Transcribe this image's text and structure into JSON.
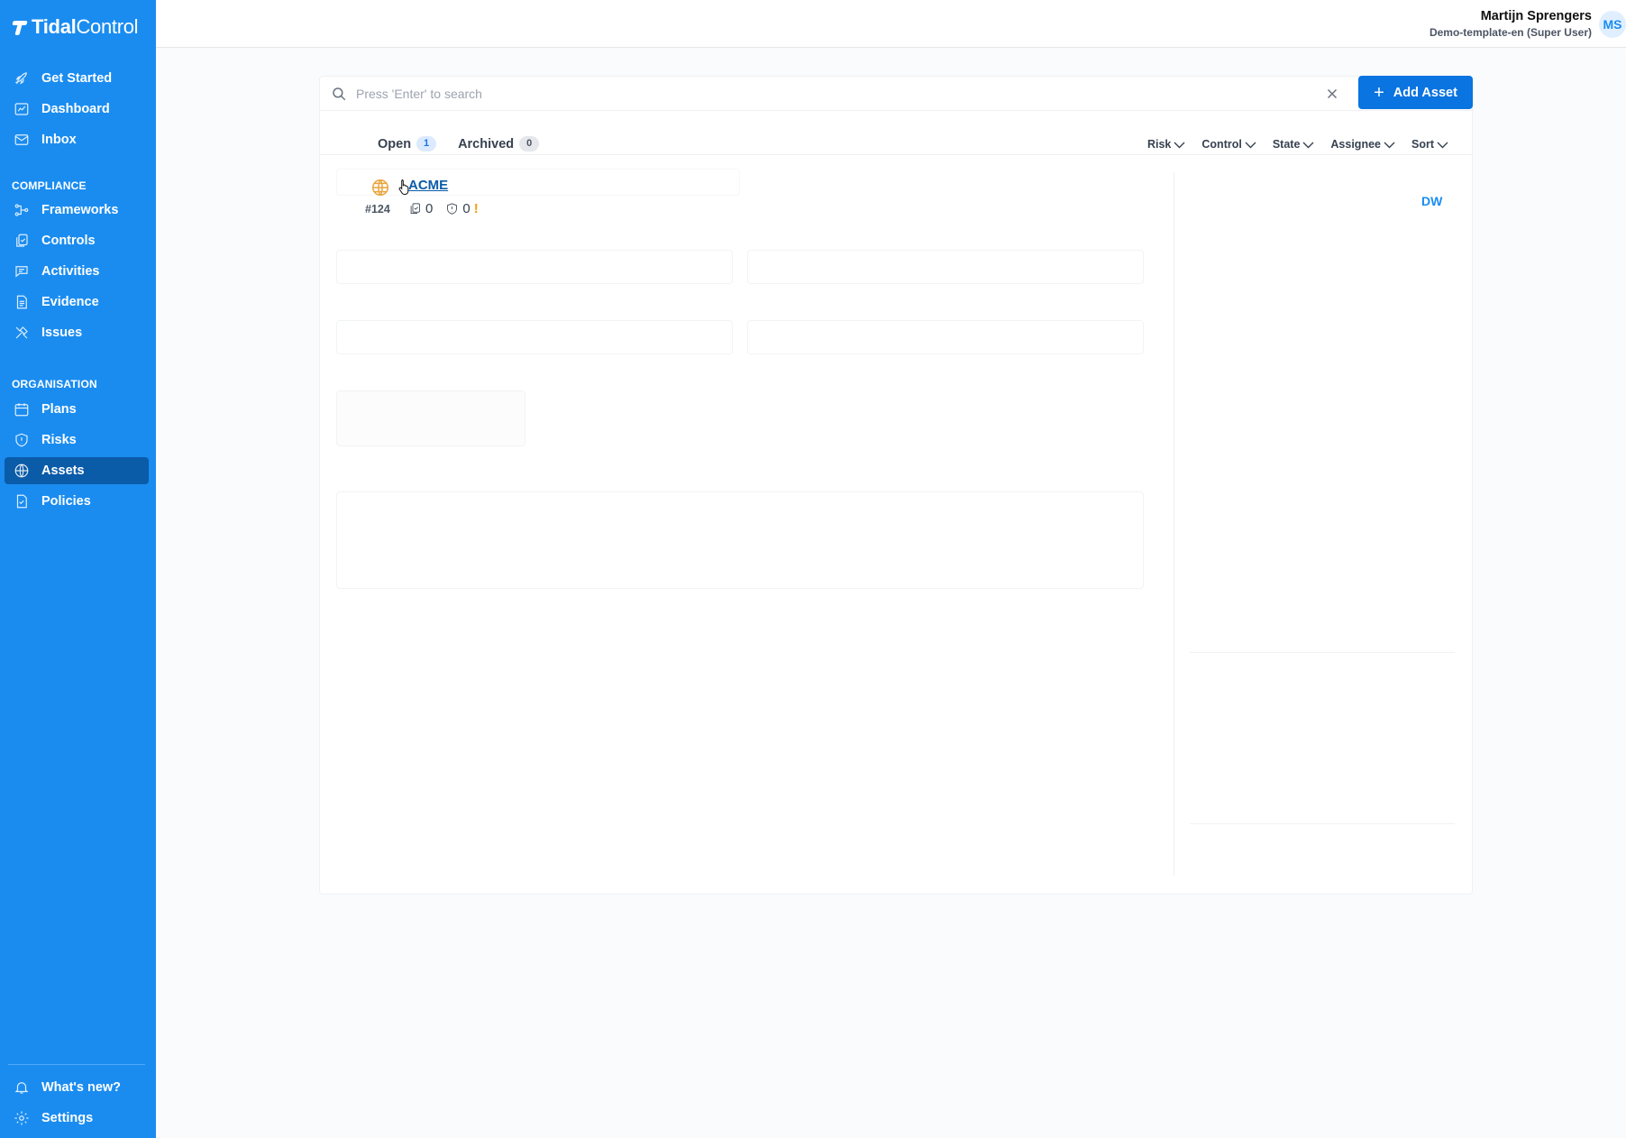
{
  "app": {
    "logo_bold": "Tidal",
    "logo_light": "Control"
  },
  "sidebar": {
    "top_items": [
      {
        "label": "Get Started",
        "icon": "rocket-icon"
      },
      {
        "label": "Dashboard",
        "icon": "dashboard-icon"
      },
      {
        "label": "Inbox",
        "icon": "mail-icon"
      }
    ],
    "sections": [
      {
        "title": "COMPLIANCE",
        "items": [
          {
            "label": "Frameworks",
            "icon": "frameworks-icon"
          },
          {
            "label": "Controls",
            "icon": "controls-icon"
          },
          {
            "label": "Activities",
            "icon": "activities-icon"
          },
          {
            "label": "Evidence",
            "icon": "evidence-icon"
          },
          {
            "label": "Issues",
            "icon": "issues-icon"
          }
        ]
      },
      {
        "title": "ORGANISATION",
        "items": [
          {
            "label": "Plans",
            "icon": "calendar-icon"
          },
          {
            "label": "Risks",
            "icon": "shield-icon"
          },
          {
            "label": "Assets",
            "icon": "globe-icon",
            "active": true
          },
          {
            "label": "Policies",
            "icon": "policy-icon"
          }
        ]
      }
    ],
    "bottom_items": [
      {
        "label": "What's new?",
        "icon": "bell-icon"
      },
      {
        "label": "Settings",
        "icon": "gear-icon"
      }
    ]
  },
  "header": {
    "user_name": "Martijn Sprengers",
    "user_org": "Demo-template-en (Super User)",
    "avatar_initials": "MS"
  },
  "search": {
    "placeholder": "Press 'Enter' to search",
    "value": ""
  },
  "toolbar": {
    "add_label": "Add Asset"
  },
  "tabs": [
    {
      "label": "Open",
      "count": "1",
      "active": true
    },
    {
      "label": "Archived",
      "count": "0"
    }
  ],
  "filters": [
    "Risk",
    "Control",
    "State",
    "Assignee",
    "Sort"
  ],
  "assets": [
    {
      "id": "#124",
      "name": "ACME",
      "controls_count": "0",
      "risks_count": "0",
      "warning": "!"
    }
  ],
  "detail": {
    "assignee_initials": "DW"
  },
  "colors": {
    "sidebar": "#1a8cf0",
    "active_nav": "#0a5ba8",
    "primary_button": "#0a74e0",
    "warning": "#f59e0b"
  }
}
